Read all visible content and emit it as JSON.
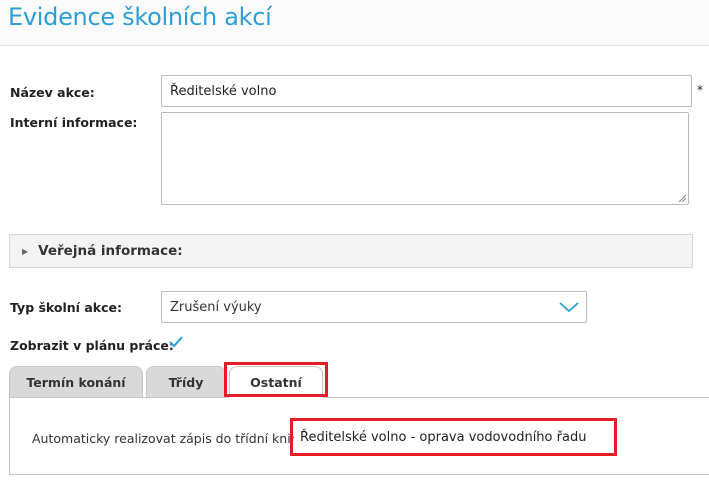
{
  "page": {
    "title": "Evidence školních akcí"
  },
  "form": {
    "name_label": "Název akce:",
    "name_value": "Ředitelské volno",
    "required_mark": "*",
    "internal_label": "Interní informace:",
    "internal_value": "",
    "public_section_label": "Veřejná informace:",
    "type_label": "Typ školní akce:",
    "type_value": "Zrušení výuky",
    "show_in_plan_label": "Zobrazit v plánu práce:",
    "show_in_plan_checked": true
  },
  "tabs": [
    {
      "label": "Termín konání",
      "active": false
    },
    {
      "label": "Třídy",
      "active": false
    },
    {
      "label": "Ostatní",
      "active": true
    }
  ],
  "ostatni": {
    "auto_record_label": "Automaticky realizovat zápis do třídní knihy:",
    "auto_record_value": "Ředitelské volno - oprava vodovodního řadu"
  },
  "colors": {
    "title": "#2b9fd6",
    "highlight": "#e41e26",
    "check": "#2b9fd6"
  },
  "icons": {
    "caret": "caret-right-icon",
    "dropdown": "chevron-down-icon",
    "check": "checkmark-icon"
  }
}
